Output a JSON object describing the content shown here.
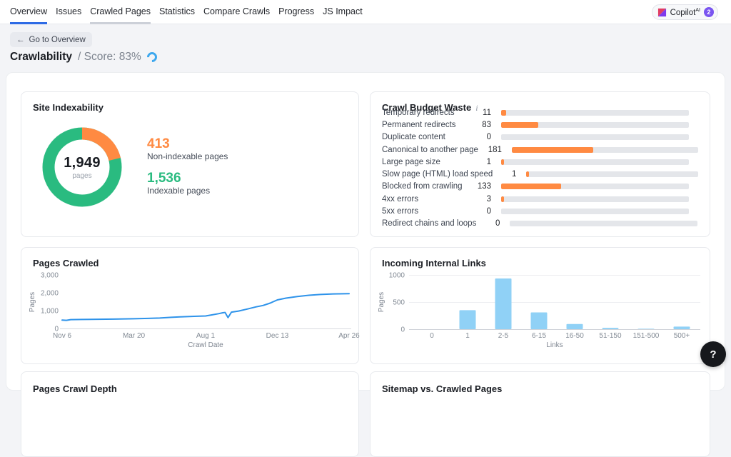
{
  "nav": {
    "tabs": [
      {
        "label": "Overview",
        "state": "active"
      },
      {
        "label": "Issues",
        "state": "default"
      },
      {
        "label": "Crawled Pages",
        "state": "hover"
      },
      {
        "label": "Statistics",
        "state": "default"
      },
      {
        "label": "Compare Crawls",
        "state": "default"
      },
      {
        "label": "Progress",
        "state": "default"
      },
      {
        "label": "JS Impact",
        "state": "default"
      }
    ],
    "copilot": {
      "label": "Copilot",
      "superscript": "AI",
      "badge": "2"
    }
  },
  "toolbar": {
    "back_button": "Go to Overview"
  },
  "page": {
    "title": "Crawlability",
    "score_label": "/ Score: 83%"
  },
  "cards": {
    "pages_crawl_depth": {
      "title": "Pages Crawl Depth"
    },
    "sitemap_vs_crawled": {
      "title": "Sitemap vs. Crawled Pages"
    }
  },
  "help_button": "?",
  "colors": {
    "accent_blue": "#2e6be5",
    "donut_green": "#2abb80",
    "donut_orange": "#ff8a42",
    "line_blue": "#2e93ea",
    "bar_light_blue": "#90d1f6",
    "track_gray": "#e4e6ea"
  },
  "chart_data": [
    {
      "type": "pie",
      "subtype": "donut",
      "title": "Site Indexability",
      "center_label": "1,949",
      "center_sublabel": "pages",
      "total": 1949,
      "slices": [
        {
          "label": "Non-indexable pages",
          "value": 413,
          "display": "413",
          "color": "#ff8a42"
        },
        {
          "label": "Indexable pages",
          "value": 1536,
          "display": "1,536",
          "color": "#2abb80"
        }
      ]
    },
    {
      "type": "bar",
      "orientation": "horizontal",
      "title": "Crawl Budget Waste",
      "categories": [
        "Temporary redirects",
        "Permanent redirects",
        "Duplicate content",
        "Canonical to another page",
        "Large page size",
        "Slow page (HTML) load speed",
        "Blocked from crawling",
        "4xx errors",
        "5xx errors",
        "Redirect chains and loops"
      ],
      "values": [
        11,
        83,
        0,
        181,
        1,
        1,
        133,
        3,
        0,
        0
      ],
      "xlim": [
        0,
        417
      ],
      "bar_color": "#ff8a42",
      "track_color": "#e4e6ea"
    },
    {
      "type": "line",
      "title": "Pages Crawled",
      "xlabel": "Crawl Date",
      "ylabel": "Pages",
      "x_tick_labels": [
        "Nov 6",
        "Mar 20",
        "Aug 1",
        "Dec 13",
        "Apr 26"
      ],
      "y_ticks": [
        0,
        1000,
        2000,
        3000
      ],
      "y_tick_labels": [
        "0",
        "1,000",
        "2,000",
        "3,000"
      ],
      "ylim": [
        0,
        3000
      ],
      "line_color": "#2e93ea",
      "points": [
        [
          0.0,
          470
        ],
        [
          0.015,
          455
        ],
        [
          0.03,
          495
        ],
        [
          0.07,
          505
        ],
        [
          0.125,
          515
        ],
        [
          0.18,
          525
        ],
        [
          0.25,
          545
        ],
        [
          0.3,
          565
        ],
        [
          0.34,
          585
        ],
        [
          0.38,
          625
        ],
        [
          0.42,
          655
        ],
        [
          0.46,
          680
        ],
        [
          0.5,
          700
        ],
        [
          0.52,
          755
        ],
        [
          0.545,
          830
        ],
        [
          0.56,
          880
        ],
        [
          0.568,
          895
        ],
        [
          0.578,
          610
        ],
        [
          0.59,
          915
        ],
        [
          0.615,
          975
        ],
        [
          0.645,
          1090
        ],
        [
          0.675,
          1210
        ],
        [
          0.7,
          1290
        ],
        [
          0.725,
          1420
        ],
        [
          0.75,
          1600
        ],
        [
          0.78,
          1700
        ],
        [
          0.82,
          1790
        ],
        [
          0.86,
          1860
        ],
        [
          0.9,
          1905
        ],
        [
          0.945,
          1935
        ],
        [
          1.0,
          1950
        ]
      ]
    },
    {
      "type": "bar",
      "orientation": "vertical",
      "title": "Incoming Internal Links",
      "xlabel": "Links",
      "ylabel": "Pages",
      "categories": [
        "0",
        "1",
        "2-5",
        "6-15",
        "16-50",
        "51-150",
        "151-500",
        "500+"
      ],
      "values": [
        0,
        350,
        935,
        310,
        95,
        25,
        8,
        48
      ],
      "y_ticks": [
        0,
        500,
        1000
      ],
      "y_tick_labels": [
        "0",
        "500",
        "1000"
      ],
      "ylim": [
        0,
        1000
      ],
      "bar_color": "#90d1f6"
    }
  ]
}
